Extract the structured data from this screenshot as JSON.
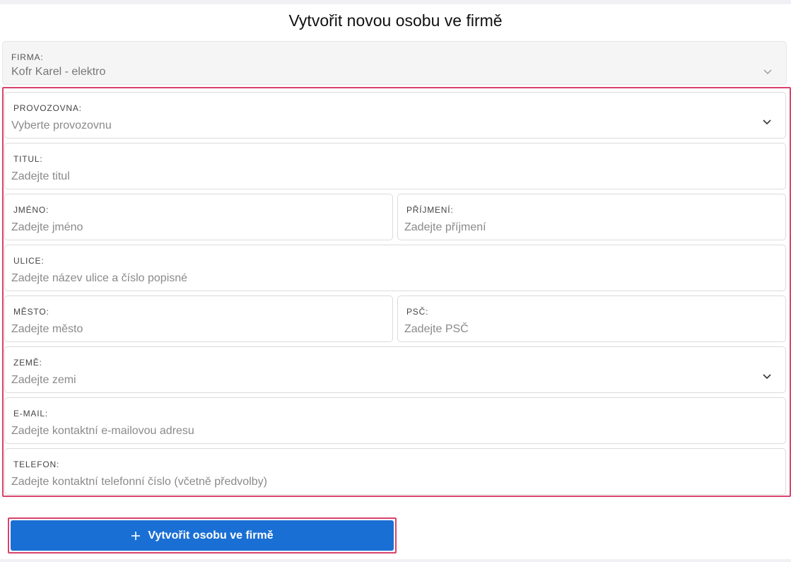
{
  "page": {
    "title": "Vytvořit novou osobu ve firmě"
  },
  "form": {
    "firma": {
      "label": "FIRMA:",
      "value": "Kofr Karel - elektro"
    },
    "provozovna": {
      "label": "PROVOZOVNA:",
      "placeholder": "Vyberte provozovnu"
    },
    "titul": {
      "label": "TITUL:",
      "placeholder": "Zadejte titul"
    },
    "jmeno": {
      "label": "JMÉNO:",
      "placeholder": "Zadejte jméno"
    },
    "prijmeni": {
      "label": "PŘÍJMENÍ:",
      "placeholder": "Zadejte příjmení"
    },
    "ulice": {
      "label": "ULICE:",
      "placeholder": "Zadejte název ulice a číslo popisné"
    },
    "mesto": {
      "label": "MĚSTO:",
      "placeholder": "Zadejte město"
    },
    "psc": {
      "label": "PSČ:",
      "placeholder": "Zadejte PSČ"
    },
    "zeme": {
      "label": "ZEMĚ:",
      "placeholder": "Zadejte zemi"
    },
    "email": {
      "label": "E-MAIL:",
      "placeholder": "Zadejte kontaktní e-mailovou adresu"
    },
    "telefon": {
      "label": "TELEFON:",
      "placeholder": "Zadejte kontaktní telefonní číslo (včetně předvolby)"
    }
  },
  "actions": {
    "submit_label": "Vytvořit osobu ve firmě",
    "submit_icon": "plus-icon"
  },
  "colors": {
    "primary": "#1a6fd4",
    "highlight": "#d9436b"
  }
}
